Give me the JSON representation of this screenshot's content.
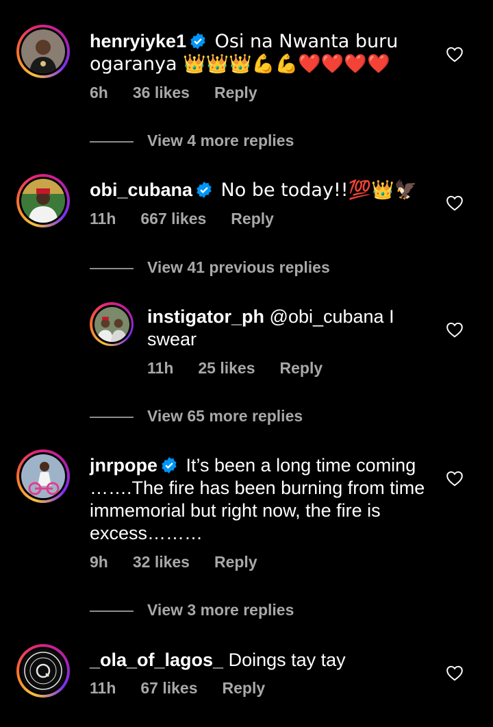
{
  "comments": [
    {
      "username": "henryiyke1",
      "text": "Osi na Nwanta buru ogaranya 👑👑👑💪💪❤️❤️❤️❤️",
      "time": "6h",
      "likes": "36 likes",
      "reply": "Reply"
    },
    {
      "username": "obi_cubana",
      "text": "No be today!!💯👑🦅",
      "time": "11h",
      "likes": "667 likes",
      "reply": "Reply"
    },
    {
      "username": "instigator_ph",
      "text": "@obi_cubana I swear",
      "time": "11h",
      "likes": "25 likes",
      "reply": "Reply"
    },
    {
      "username": "jnrpope",
      "text": "It’s been a long time coming …….The fire has been burning from time immemorial but right now, the fire is excess………",
      "time": "9h",
      "likes": "32 likes",
      "reply": "Reply"
    },
    {
      "username": "_ola_of_lagos_",
      "text": "Doings tay tay",
      "time": "11h",
      "likes": "67 likes",
      "reply": "Reply"
    }
  ],
  "view_more": {
    "first": "View 4 more replies",
    "previous": "View 41 previous replies",
    "second": "View 65 more replies",
    "third": "View 3 more replies"
  },
  "colors": {
    "background": "#000000",
    "secondary_text": "#a8a8a8",
    "verified": "#0095f6",
    "avatar_ring_start": "#f9c33a",
    "avatar_ring_end": "#b31fa8"
  },
  "icons": [
    "verified-badge-icon",
    "heart-outline-icon"
  ]
}
